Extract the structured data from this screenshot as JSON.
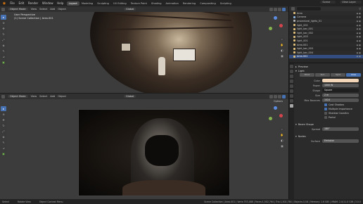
{
  "menu": [
    "File",
    "Edit",
    "Render",
    "Window",
    "Help"
  ],
  "workspaces": [
    "Layout",
    "Modeling",
    "Sculpting",
    "UV Editing",
    "Texture Paint",
    "Shading",
    "Animation",
    "Rendering",
    "Compositing",
    "Scripting"
  ],
  "active_workspace": "Layout",
  "scene_field": "Scene",
  "view_layer_field": "View Layer",
  "viewport_top": {
    "mode": "Object Mode",
    "menus": [
      "View",
      "Select",
      "Add",
      "Object"
    ],
    "orientation": "Global",
    "info_line1": "User Perspective",
    "info_line2": "(1) Scene Collection | Area.001"
  },
  "viewport_bottom": {
    "mode": "Object Mode",
    "menus": [
      "View",
      "Select",
      "Add",
      "Object"
    ],
    "orientation": "Global",
    "options": "Options"
  },
  "outliner": {
    "rows": [
      {
        "name": "Area",
        "color": "#e0c07a"
      },
      {
        "name": "Camera",
        "color": "#8fb8de"
      },
      {
        "name": "procedural_lights_01",
        "color": "#b5b5b5"
      },
      {
        "name": "light_002",
        "color": "#e0c07a"
      },
      {
        "name": "light_bar_001",
        "color": "#e0c07a"
      },
      {
        "name": "light_bar_002",
        "color": "#e0c07a"
      },
      {
        "name": "light_003",
        "color": "#e0c07a"
      },
      {
        "name": "light_001",
        "color": "#e0c07a"
      },
      {
        "name": "Area.001",
        "color": "#e0c07a"
      },
      {
        "name": "light_bar_003",
        "color": "#e0c07a"
      },
      {
        "name": "light_bar_004",
        "color": "#e0c07a"
      },
      {
        "name": "Area.002",
        "color": "#e0c07a"
      }
    ],
    "selected_index": 11
  },
  "properties": {
    "preview_label": "Preview",
    "light_label": "Light",
    "light_types": [
      "Point",
      "Sun",
      "Spot",
      "Area"
    ],
    "active_light_type": "Area",
    "color_label": "Color",
    "color_value": "#f3d6b8",
    "power_label": "Power",
    "power_value": "1000 W",
    "shape_label": "Shape",
    "shape_value": "Square",
    "size_label": "Size",
    "size_value": "2 m",
    "max_bounces_label": "Max Bounces",
    "max_bounces_value": "1024",
    "checks": [
      {
        "label": "Cast Shadow",
        "on": true
      },
      {
        "label": "Multiple Importance",
        "on": true
      },
      {
        "label": "Shadow Caustics",
        "on": false
      },
      {
        "label": "Portal",
        "on": false
      }
    ],
    "beam_shape_label": "Beam Shape",
    "spread_label": "Spread",
    "spread_value": "180°",
    "nodes_label": "Nodes",
    "surface_label": "Surface",
    "surface_value": "Emission"
  },
  "statusbar": {
    "hints": [
      "Select",
      "Rotate View",
      "Object Context Menu"
    ],
    "stats": "Scene Collection | Area.001 | Verts:753,488 | Faces:1,502,764 | Tris:1,502,764 | Objects:1/18 | Memory: 1.6 GiB | VRAM: 2.0/11.0 GiB | 3.0.0"
  }
}
